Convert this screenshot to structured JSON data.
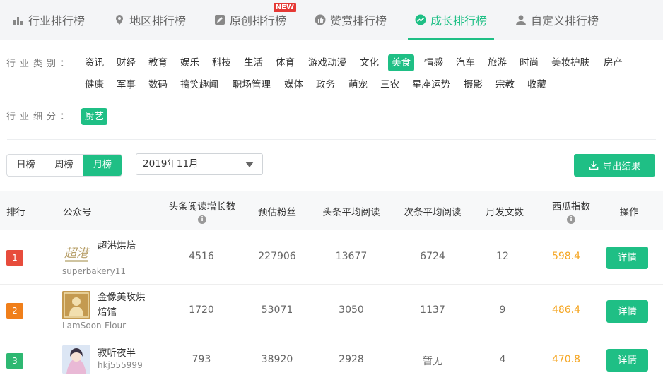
{
  "tabs": [
    {
      "label": "行业排行榜",
      "icon": "bar-chart-icon"
    },
    {
      "label": "地区排行榜",
      "icon": "location-pin-icon"
    },
    {
      "label": "原创排行榜",
      "icon": "edit-icon",
      "badge": "NEW"
    },
    {
      "label": "赞赏排行榜",
      "icon": "thumbs-up-icon"
    },
    {
      "label": "成长排行榜",
      "icon": "growth-chart-icon",
      "active": true
    },
    {
      "label": "自定义排行榜",
      "icon": "user-icon"
    }
  ],
  "filters": {
    "category_label": "行业类别：",
    "categories_row1": [
      "资讯",
      "财经",
      "教育",
      "娱乐",
      "科技",
      "生活",
      "体育",
      "游戏动漫",
      "文化",
      "美食",
      "情感",
      "汽车",
      "旅游",
      "时尚",
      "美妆护肤",
      "房产"
    ],
    "categories_row2": [
      "健康",
      "军事",
      "数码",
      "搞笑趣闻",
      "职场管理",
      "媒体",
      "政务",
      "萌宠",
      "三农",
      "星座运势",
      "摄影",
      "宗教",
      "收藏"
    ],
    "selected_category": "美食",
    "subcategory_label": "行业细分：",
    "subcategory": "厨艺"
  },
  "period": {
    "options": [
      "日榜",
      "周榜",
      "月榜"
    ],
    "selected": "月榜"
  },
  "date_select": {
    "value": "2019年11月"
  },
  "export_label": "导出结果",
  "colors": {
    "accent": "#1fbf85",
    "rank1": "#e74c3c",
    "rank2": "#f07f1a",
    "rank3": "#2eb872",
    "index": "#f5a623"
  },
  "table": {
    "headers": {
      "rank": "排行",
      "account": "公众号",
      "headline_read_growth": "头条阅读增长数",
      "est_fans": "预估粉丝",
      "headline_avg_read": "头条平均阅读",
      "second_avg_read": "次条平均阅读",
      "monthly_posts": "月发文数",
      "xigua_index": "西瓜指数",
      "action": "操作"
    },
    "rows": [
      {
        "rank": "1",
        "name": "超港烘焙",
        "id": "superbakery11",
        "growth": "4516",
        "fans": "227906",
        "head_avg": "13677",
        "second_avg": "6724",
        "posts": "12",
        "index": "598.4",
        "action": "详情"
      },
      {
        "rank": "2",
        "name_line1": "金像美玫烘",
        "name_line2": "焙馆",
        "id": "LamSoon-Flour",
        "growth": "1720",
        "fans": "53071",
        "head_avg": "3050",
        "second_avg": "1137",
        "posts": "9",
        "index": "486.4",
        "action": "详情"
      },
      {
        "rank": "3",
        "name": "寂听夜半",
        "id": "hkj555999",
        "growth": "793",
        "fans": "38920",
        "head_avg": "2928",
        "second_avg": "暂无",
        "posts": "4",
        "index": "470.8",
        "action": "详情"
      }
    ]
  }
}
